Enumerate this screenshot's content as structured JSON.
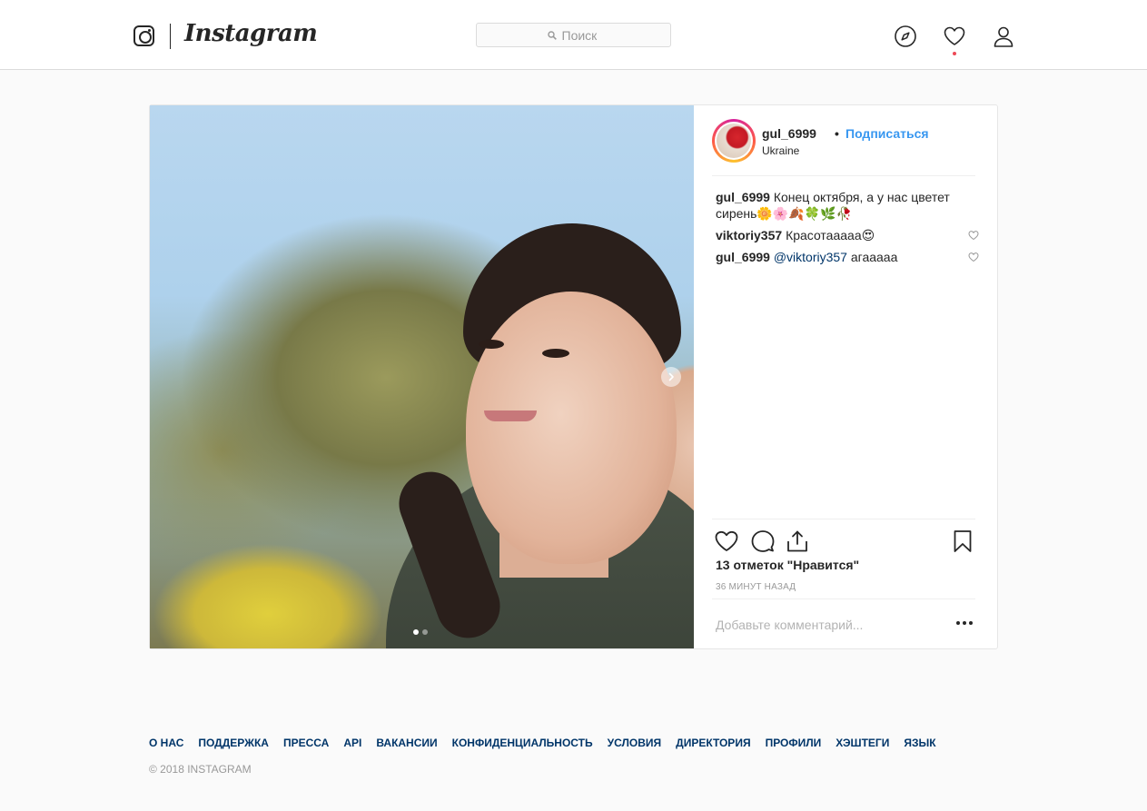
{
  "header": {
    "logo_icon": "instagram-camera-icon",
    "wordmark": "Instagram",
    "search_placeholder": "Поиск",
    "search_icon": "search-icon",
    "nav_icons": [
      "compass-icon",
      "heart-icon",
      "profile-icon"
    ],
    "notification_dot_color": "#ed4956"
  },
  "post": {
    "author": "gul_6999",
    "separator": "•",
    "follow_label": "Подписаться",
    "location": "Ukraine",
    "carousel_slide_count": 2,
    "carousel_active_index": 0,
    "comments": [
      {
        "user": "gul_6999",
        "text": "Конец октября, а у нас цветет сирень🌼🌸🍂🍀🌿🥀",
        "likeable": false
      },
      {
        "user": "viktoriy357",
        "text": "Красотааааа😍",
        "likeable": true
      },
      {
        "user": "gul_6999",
        "mention": "@viktoriy357",
        "text": " агааааа",
        "likeable": true
      }
    ],
    "likes": "13 отметок \"Нравится\"",
    "timestamp": "36 минут назад",
    "comment_placeholder": "Добавьте комментарий...",
    "action_icons": [
      "like-icon",
      "comment-icon",
      "share-icon",
      "bookmark-icon"
    ]
  },
  "footer": {
    "links": [
      "О нас",
      "Поддержка",
      "Пресса",
      "API",
      "Вакансии",
      "Конфиденциальность",
      "Условия",
      "Директория",
      "Профили",
      "Хэштеги",
      "Язык"
    ],
    "copyright": "© 2018 Instagram"
  },
  "colors": {
    "link_blue": "#3897f0",
    "footer_link": "#003569",
    "border": "#dbdbdb",
    "background": "#fafafa"
  }
}
